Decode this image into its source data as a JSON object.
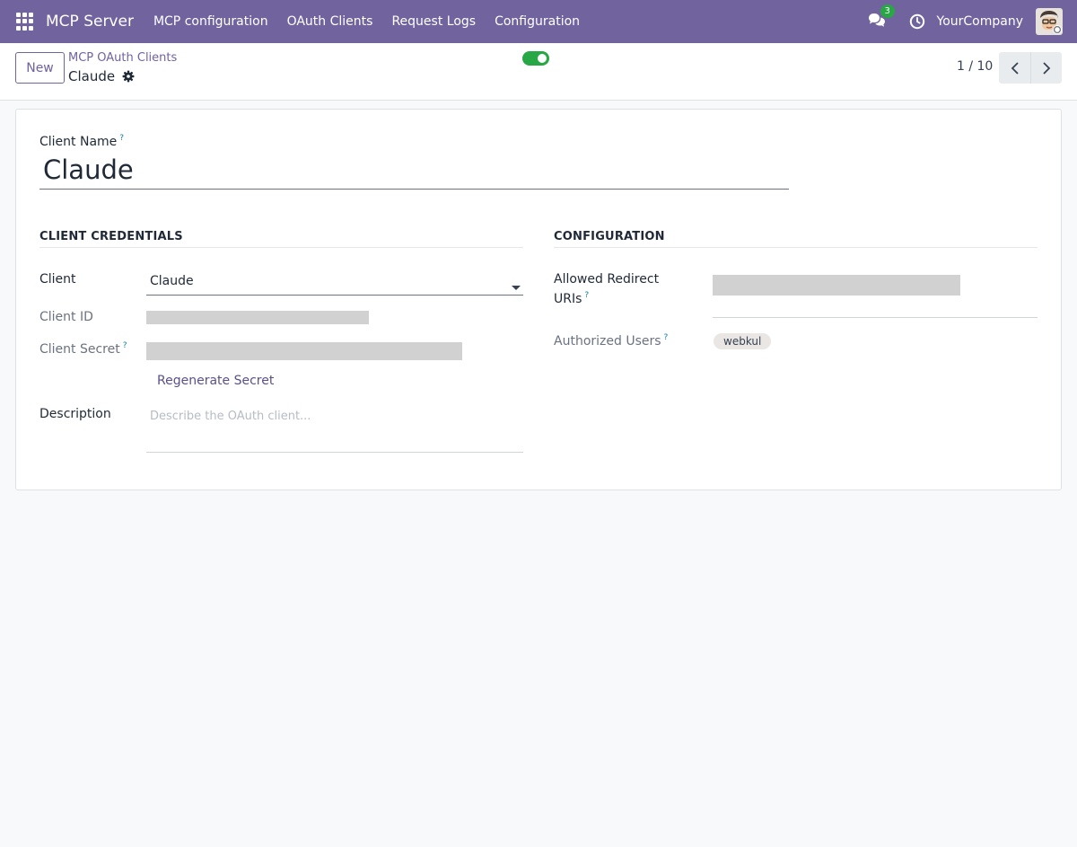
{
  "navbar": {
    "app_title": "MCP Server",
    "menu": [
      "MCP configuration",
      "OAuth Clients",
      "Request Logs",
      "Configuration"
    ],
    "chat_count": "3",
    "company": "YourCompany"
  },
  "control_panel": {
    "new_label": "New",
    "breadcrumb_parent": "MCP OAuth Clients",
    "breadcrumb_current": "Claude",
    "active": true,
    "pager": "1 / 10"
  },
  "form": {
    "client_name_label": "Client Name",
    "client_name_value": "Claude",
    "help_mark": "?",
    "credentials": {
      "title": "CLIENT CREDENTIALS",
      "client_label": "Client",
      "client_value": "Claude",
      "client_id_label": "Client ID",
      "client_secret_label": "Client Secret",
      "regenerate_label": "Regenerate Secret",
      "description_label": "Description",
      "description_placeholder": "Describe the OAuth client..."
    },
    "configuration": {
      "title": "CONFIGURATION",
      "redirect_label_line1": "Allowed Redirect",
      "redirect_label_line2": "URIs",
      "authorized_users_label": "Authorized Users",
      "authorized_users_tags": [
        "webkul"
      ]
    }
  },
  "colors": {
    "navbar": "#71639e",
    "toggle_on": "#28a745",
    "badge": "#28a745",
    "help": "#0d7ea3"
  }
}
